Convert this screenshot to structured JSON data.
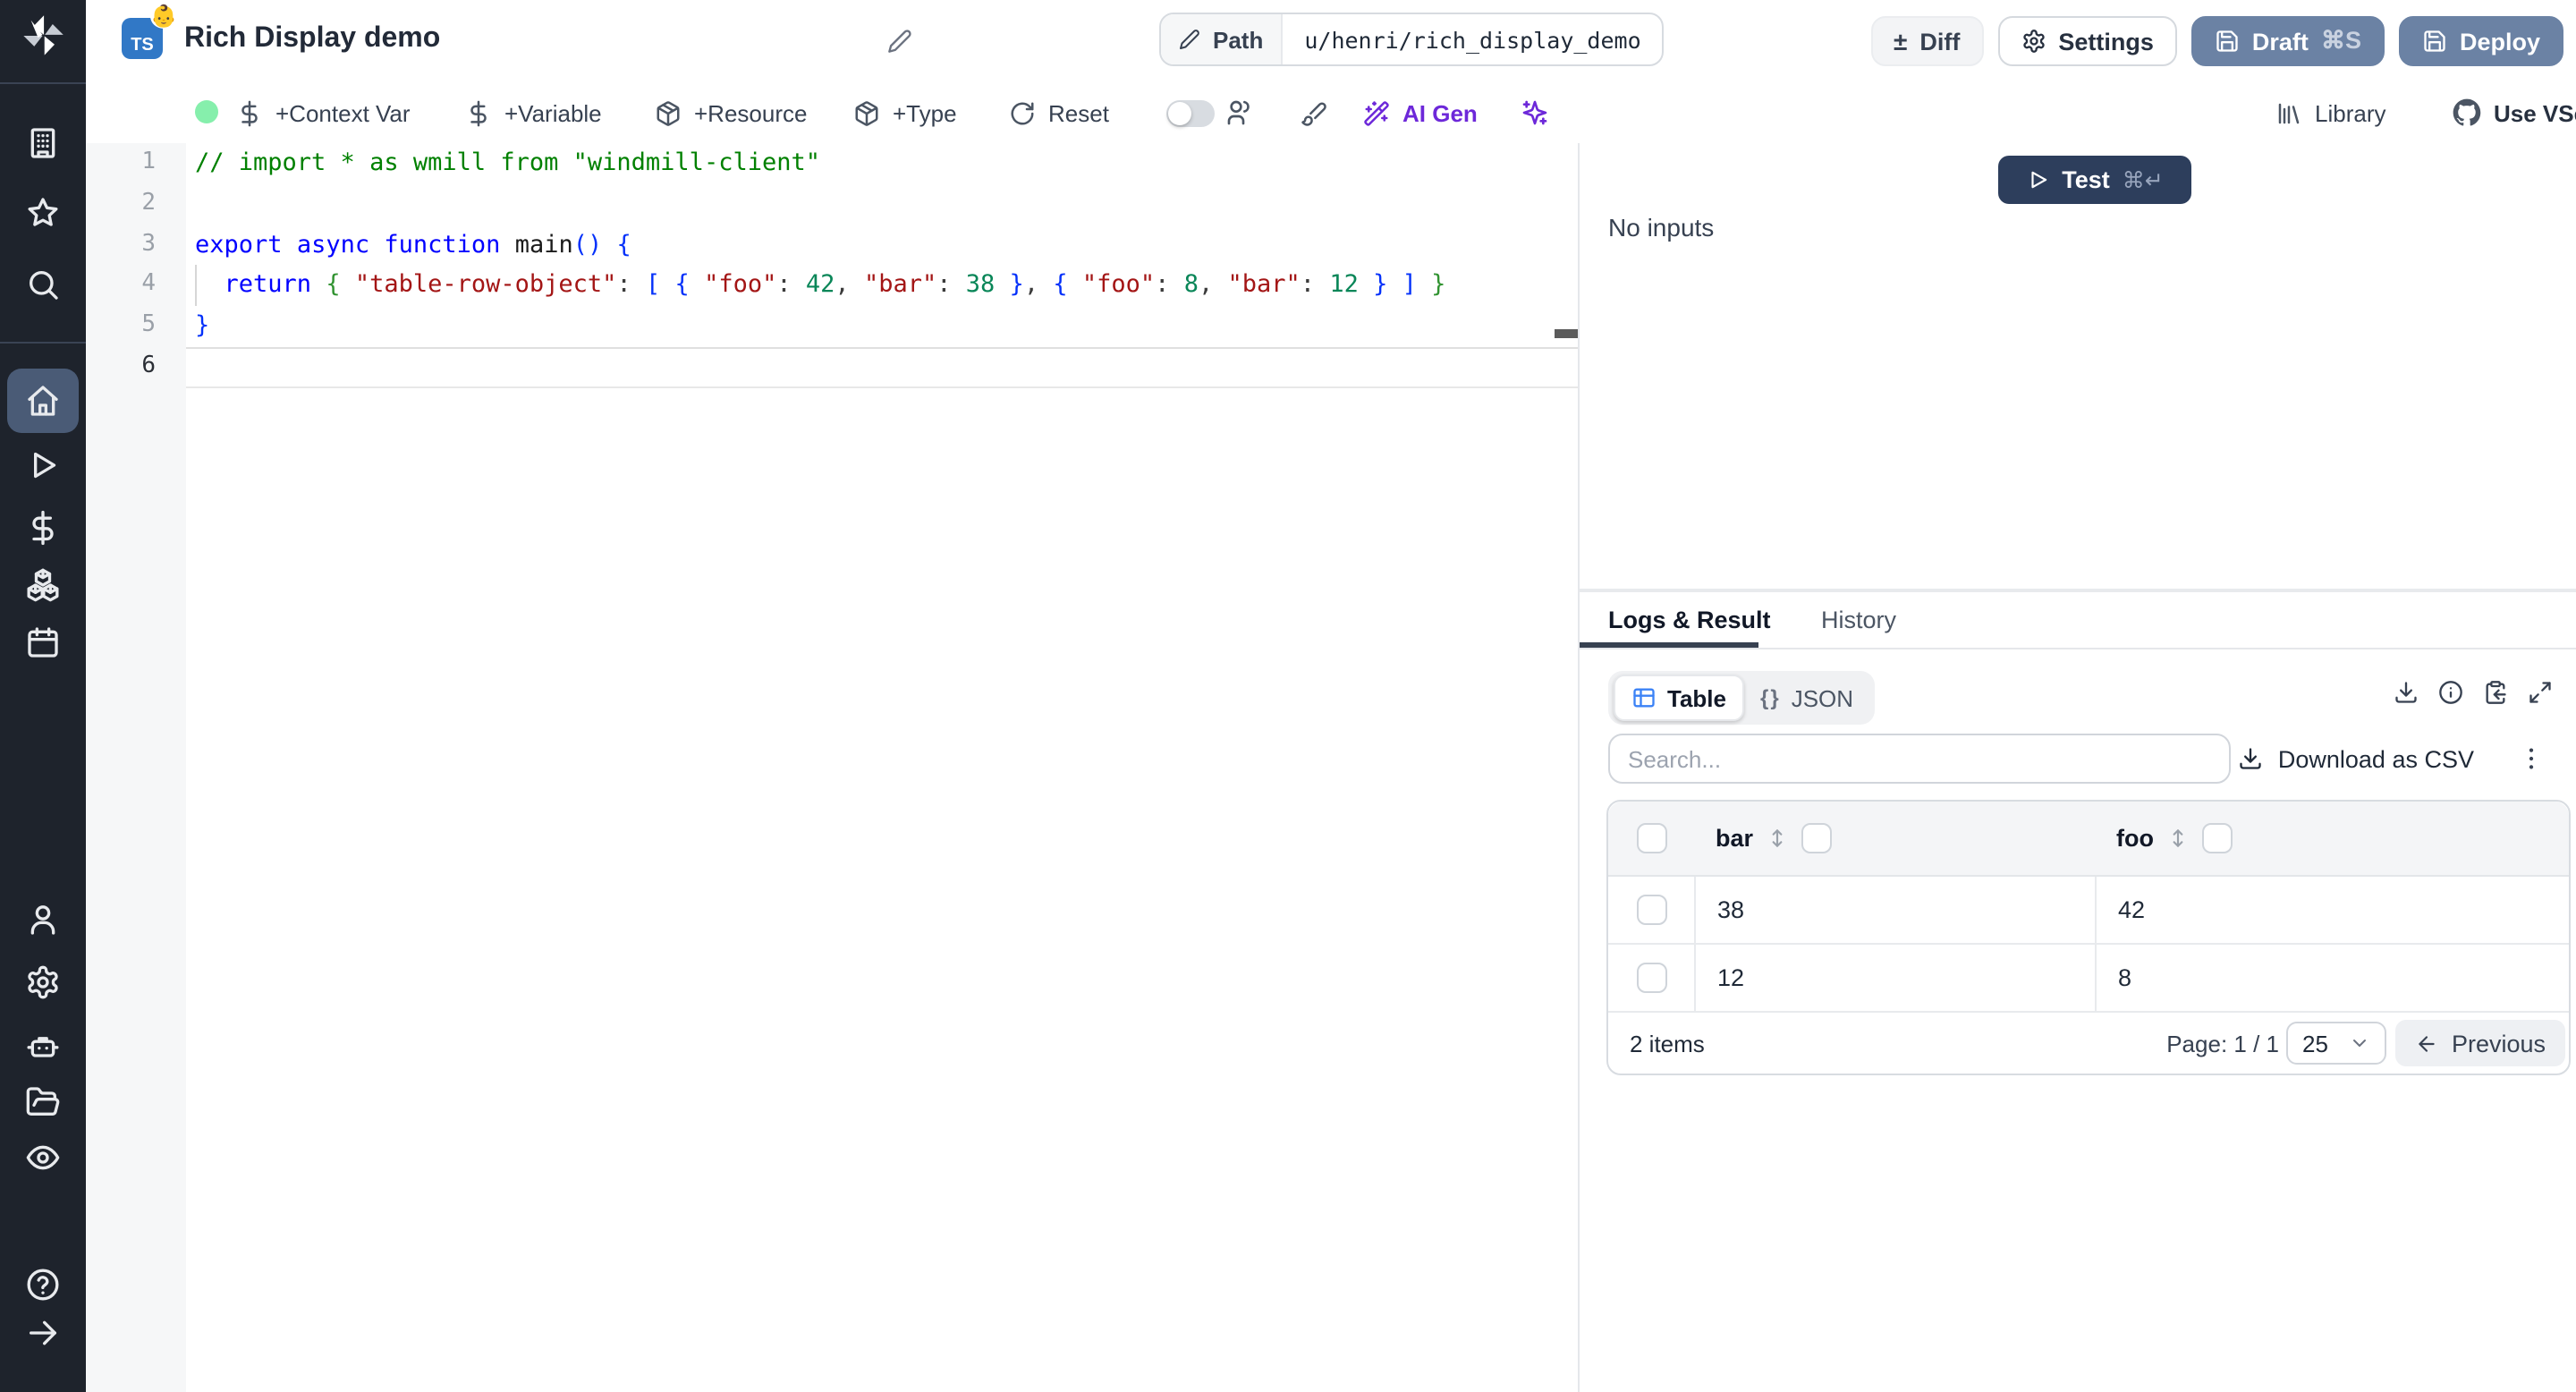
{
  "sidebar": {
    "icons": [
      "windmill-logo",
      "building",
      "star",
      "search",
      "home",
      "play",
      "dollar",
      "cubes",
      "calendar",
      "user",
      "settings",
      "robot",
      "folder",
      "eye",
      "help",
      "expand-arrow"
    ],
    "active_item": "home"
  },
  "topbar": {
    "language_badge": "TS",
    "language_emoji": "👶",
    "title": "Rich Display demo",
    "path_label": "Path",
    "path_value": "u/henri/rich_display_demo",
    "diff_label": "Diff",
    "diff_glyph": "±",
    "settings_label": "Settings",
    "draft_label": "Draft",
    "draft_shortcut": "⌘S",
    "deploy_label": "Deploy"
  },
  "toolbar": {
    "context_var": "+Context Var",
    "variable": "+Variable",
    "resource": "+Resource",
    "type": "+Type",
    "reset": "Reset",
    "ai_gen": "AI Gen",
    "library": "Library",
    "vscode": "Use VScode",
    "status_color": "#86efac"
  },
  "editor": {
    "lines": [
      {
        "n": "1",
        "t": [
          [
            "// import * as wmill from \"windmill-client\"",
            "cmt"
          ]
        ]
      },
      {
        "n": "2",
        "t": []
      },
      {
        "n": "3",
        "t": [
          [
            "export ",
            "kw"
          ],
          [
            "async ",
            "kw"
          ],
          [
            "function ",
            "kw"
          ],
          [
            "main",
            "fn"
          ],
          [
            "() {",
            "br1"
          ]
        ]
      },
      {
        "n": "4",
        "t": [
          [
            "  return ",
            "kw"
          ],
          [
            "{ ",
            "br2"
          ],
          [
            "\"table-row-object\"",
            "str"
          ],
          [
            ": ",
            "pl"
          ],
          [
            "[ ",
            "br1"
          ],
          [
            "{ ",
            "br1"
          ],
          [
            "\"foo\"",
            "str"
          ],
          [
            ": ",
            "pl"
          ],
          [
            "42",
            "num"
          ],
          [
            ", ",
            "pl"
          ],
          [
            "\"bar\"",
            "str"
          ],
          [
            ": ",
            "pl"
          ],
          [
            "38",
            "num"
          ],
          [
            " }",
            "br1"
          ],
          [
            ", ",
            "pl"
          ],
          [
            "{ ",
            "br1"
          ],
          [
            "\"foo\"",
            "str"
          ],
          [
            ": ",
            "pl"
          ],
          [
            "8",
            "num"
          ],
          [
            ", ",
            "pl"
          ],
          [
            "\"bar\"",
            "str"
          ],
          [
            ": ",
            "pl"
          ],
          [
            "12",
            "num"
          ],
          [
            " }",
            "br1"
          ],
          [
            " ] ",
            "br1"
          ],
          [
            "}",
            "br2"
          ]
        ]
      },
      {
        "n": "5",
        "t": [
          [
            "}",
            "br1"
          ]
        ]
      },
      {
        "n": "6",
        "t": [],
        "active": true
      }
    ]
  },
  "run_panel": {
    "test_label": "Test",
    "test_shortcut": "⌘↵",
    "no_inputs": "No inputs"
  },
  "result_panel": {
    "tabs": [
      "Logs & Result",
      "History"
    ],
    "views": {
      "table": "Table",
      "json": "JSON",
      "json_glyph": "{}"
    },
    "search_placeholder": "Search...",
    "download_csv": "Download as CSV",
    "table": {
      "columns": [
        "bar",
        "foo"
      ],
      "rows": [
        [
          "38",
          "42"
        ],
        [
          "12",
          "8"
        ]
      ],
      "items_label": "2 items",
      "page_label": "Page: 1 / 1",
      "page_size": "25",
      "previous_label": "Previous"
    }
  },
  "colors": {
    "accent_slate_button": "#6b82a4",
    "test_button": "#2d3e5c",
    "sidebar_bg": "#1e232c",
    "sidebar_active": "#4a5b76",
    "ai_purple": "#6d28d9",
    "status_green": "#86efac",
    "ts_blue": "#3178c6"
  }
}
